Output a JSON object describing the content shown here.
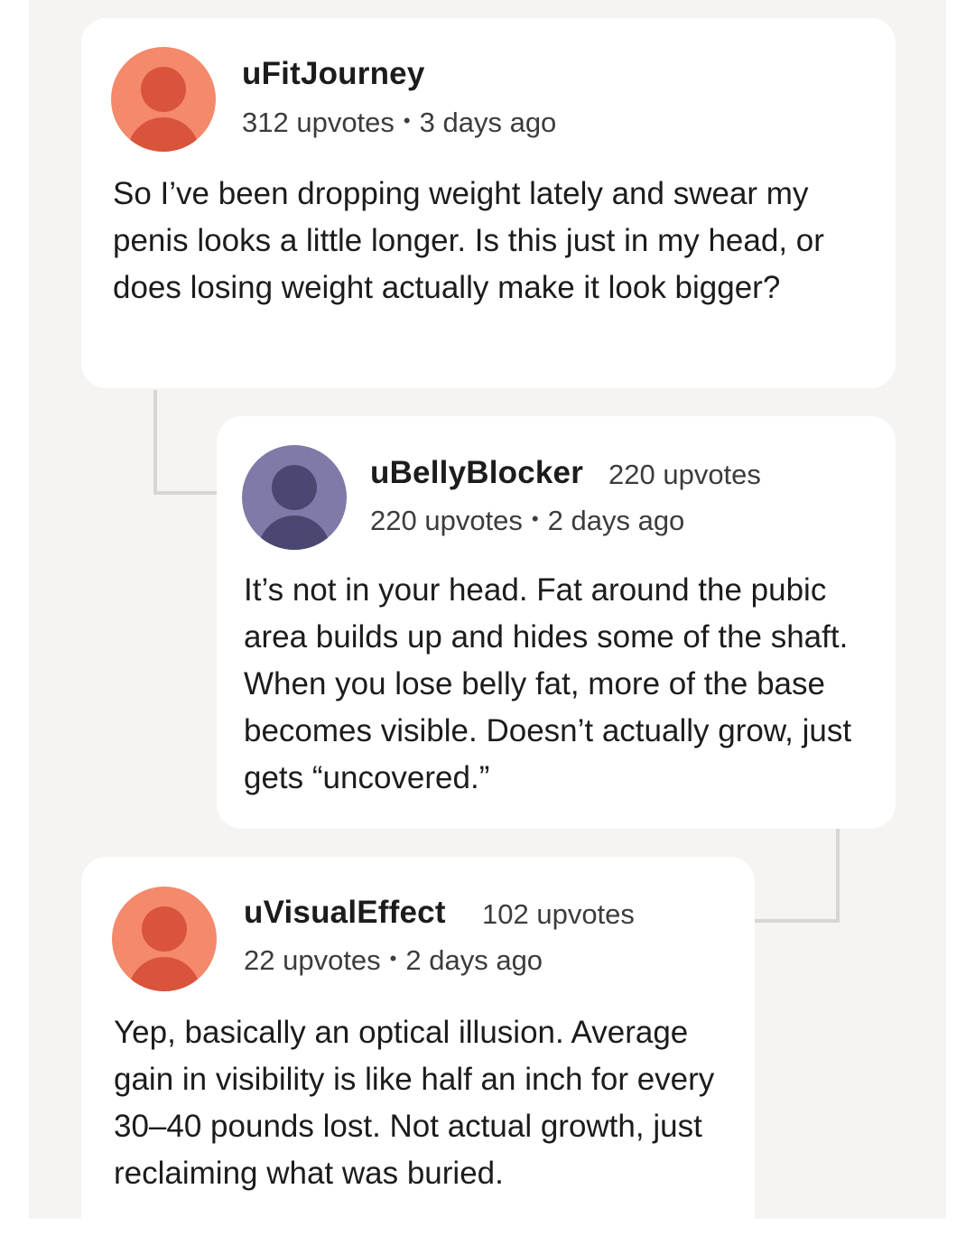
{
  "comments": [
    {
      "username": "uFitJourney",
      "inline_upvotes": "",
      "upvotes": "312 upvotes",
      "time": "3 days ago",
      "text": "So I’ve been dropping weight lately and swear my penis looks a little longer. Is this just in my head, or does losing weight actually make it look bigger?",
      "avatar_color": "#f4896b"
    },
    {
      "username": "uBellyBlocker",
      "inline_upvotes": "220 upvotes",
      "upvotes": "220 upvotes",
      "time": "2 days ago",
      "text": "It’s not in your head. Fat around the pubic area builds up and hides some of the shaft. When you lose belly fat, more of the base becomes visible. Doesn’t actually grow, just gets “uncovered.”",
      "avatar_color": "#7f7aa8"
    },
    {
      "username": "uVisualEffect",
      "inline_upvotes": "102 upvotes",
      "upvotes": "22 upvotes",
      "time": "2 days ago",
      "text": "Yep, basically an optical illusion. Average gain in visibility is like half an inch for every 30–40 pounds lost. Not actual growth, just reclaiming what was buried.",
      "avatar_color": "#f4896b"
    }
  ],
  "separator": "•"
}
